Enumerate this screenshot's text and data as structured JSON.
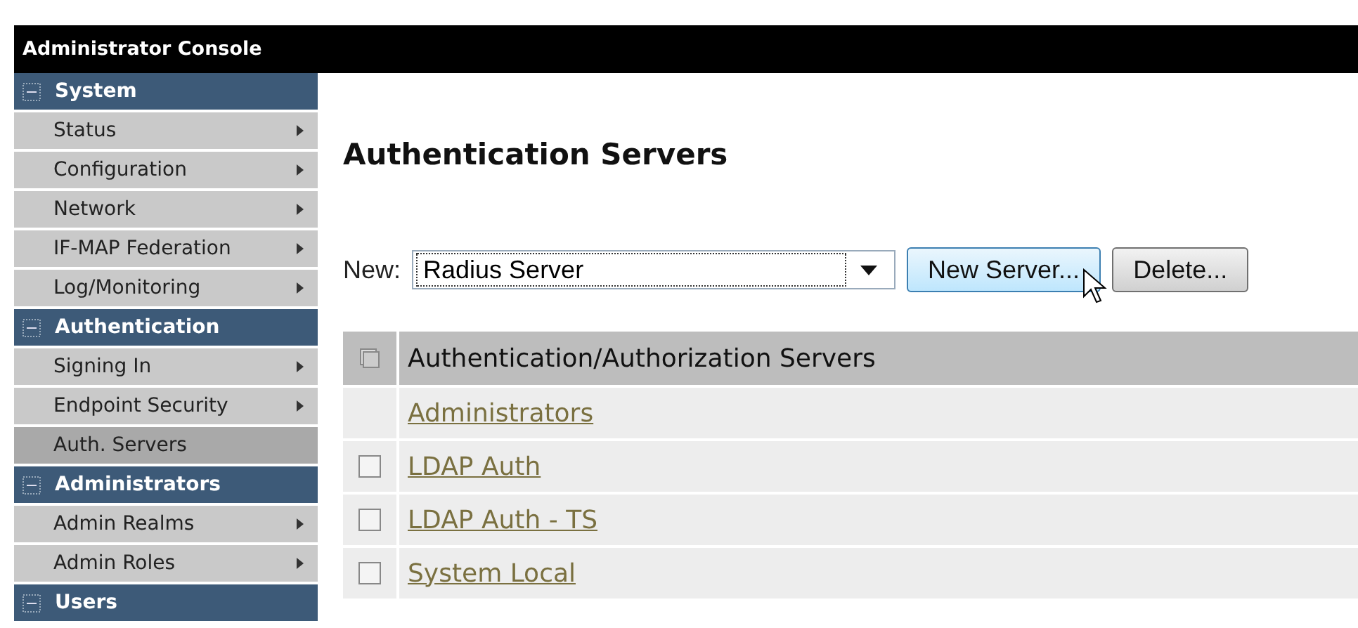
{
  "header": {
    "title": "Administrator Console"
  },
  "sidebar": {
    "items": [
      {
        "kind": "section",
        "label": "System",
        "expanded": true
      },
      {
        "kind": "link",
        "label": "Status",
        "selected": false,
        "submenu": true
      },
      {
        "kind": "link",
        "label": "Configuration",
        "selected": false,
        "submenu": true
      },
      {
        "kind": "link",
        "label": "Network",
        "selected": false,
        "submenu": true
      },
      {
        "kind": "link",
        "label": "IF-MAP Federation",
        "selected": false,
        "submenu": true
      },
      {
        "kind": "link",
        "label": "Log/Monitoring",
        "selected": false,
        "submenu": true
      },
      {
        "kind": "section",
        "label": "Authentication",
        "expanded": true
      },
      {
        "kind": "link",
        "label": "Signing In",
        "selected": false,
        "submenu": true
      },
      {
        "kind": "link",
        "label": "Endpoint Security",
        "selected": false,
        "submenu": true
      },
      {
        "kind": "link",
        "label": "Auth. Servers",
        "selected": true,
        "submenu": false
      },
      {
        "kind": "section",
        "label": "Administrators",
        "expanded": true
      },
      {
        "kind": "link",
        "label": "Admin Realms",
        "selected": false,
        "submenu": true
      },
      {
        "kind": "link",
        "label": "Admin Roles",
        "selected": false,
        "submenu": true
      },
      {
        "kind": "section",
        "label": "Users",
        "expanded": true
      }
    ]
  },
  "page_title": "Authentication Servers",
  "new_server": {
    "label": "New:",
    "value": "Radius Server",
    "buttons": [
      {
        "label": "New Server...",
        "hovered": true
      },
      {
        "label": "Delete...",
        "hovered": false
      }
    ]
  },
  "table": {
    "header": "Authentication/Authorization Servers",
    "rows": [
      {
        "name": "Administrators",
        "selectable": false
      },
      {
        "name": "LDAP Auth",
        "selectable": true,
        "checked": false
      },
      {
        "name": "LDAP Auth - TS",
        "selectable": true,
        "checked": false
      },
      {
        "name": "System Local",
        "selectable": true,
        "checked": false
      }
    ]
  }
}
